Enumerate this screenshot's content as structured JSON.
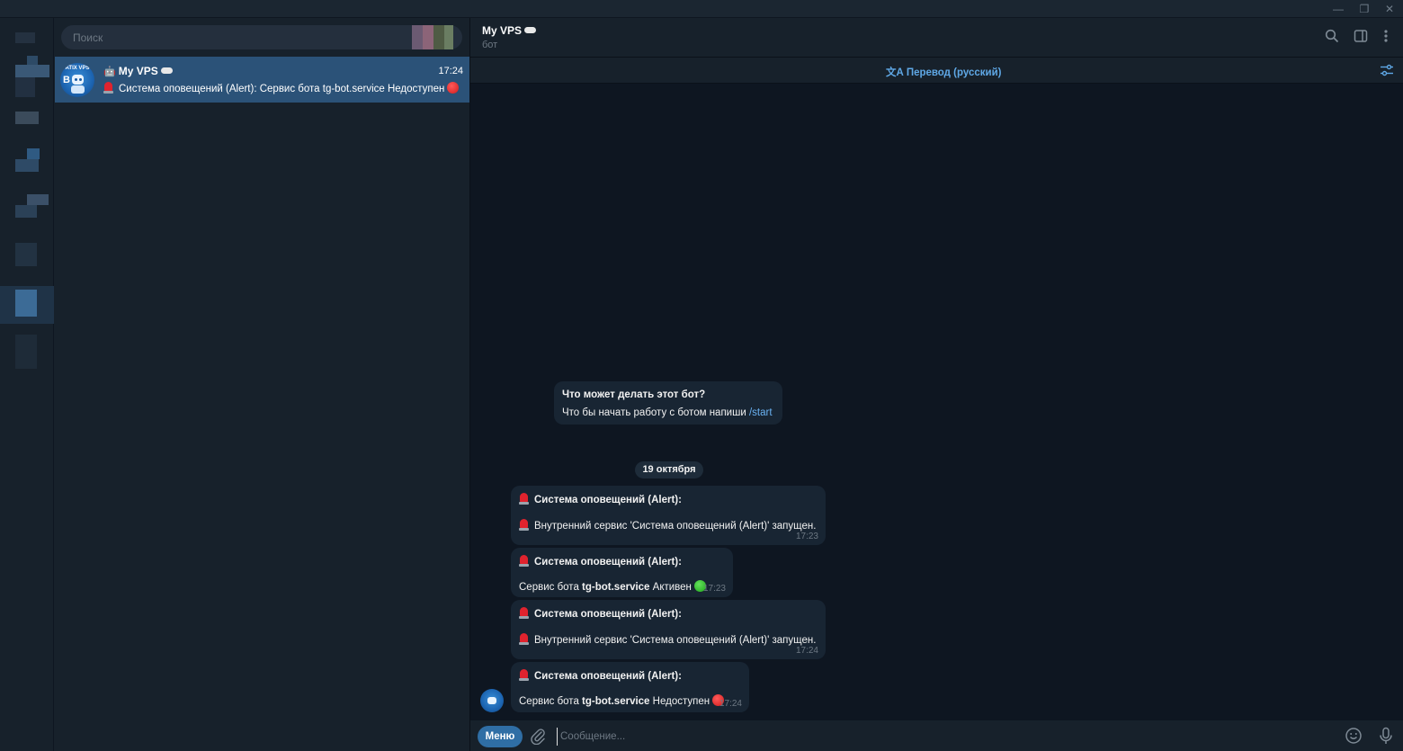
{
  "window": {
    "minimize": "—",
    "maximize": "❐",
    "close": "✕"
  },
  "search": {
    "placeholder": "Поиск"
  },
  "chat_list": {
    "items": [
      {
        "name": "My VPS",
        "time": "17:24",
        "preview": "Система оповещений (Alert):  Сервис бота tg-bot.service Недоступен",
        "avatar_text": "ATIX VPS",
        "avatar_letters": "B"
      }
    ]
  },
  "header": {
    "title": "My VPS",
    "subtitle": "бот"
  },
  "translate": {
    "label": "Перевод (русский)"
  },
  "intro": {
    "title": "Что может делать этот бот?",
    "text": "Что бы начать работу с ботом напиши ",
    "command": "/start"
  },
  "date_separator": "19 октября",
  "messages": [
    {
      "title": "Система оповещений (Alert):",
      "body": "Внутренний сервис 'Система оповещений (Alert)' запущен.",
      "time": "17:23"
    },
    {
      "title": "Система оповещений (Alert):",
      "body_prefix": "Сервис бота ",
      "body_bold": "tg-bot.service",
      "body_suffix": " Активен",
      "time": "17:23",
      "status": "green"
    },
    {
      "title": "Система оповещений (Alert):",
      "body": "Внутренний сервис 'Система оповещений (Alert)' запущен.",
      "time": "17:24"
    },
    {
      "title": "Система оповещений (Alert):",
      "body_prefix": "Сервис бота ",
      "body_bold": "tg-bot.service",
      "body_suffix": " Недоступен",
      "time": "17:24",
      "status": "red"
    }
  ],
  "composer": {
    "menu_label": "Меню",
    "placeholder": "Сообщение..."
  },
  "colors": {
    "background": "#0e1621",
    "panel": "#17212b",
    "selected": "#2b5278",
    "bubble": "#182533",
    "accent": "#5fa8e6"
  }
}
